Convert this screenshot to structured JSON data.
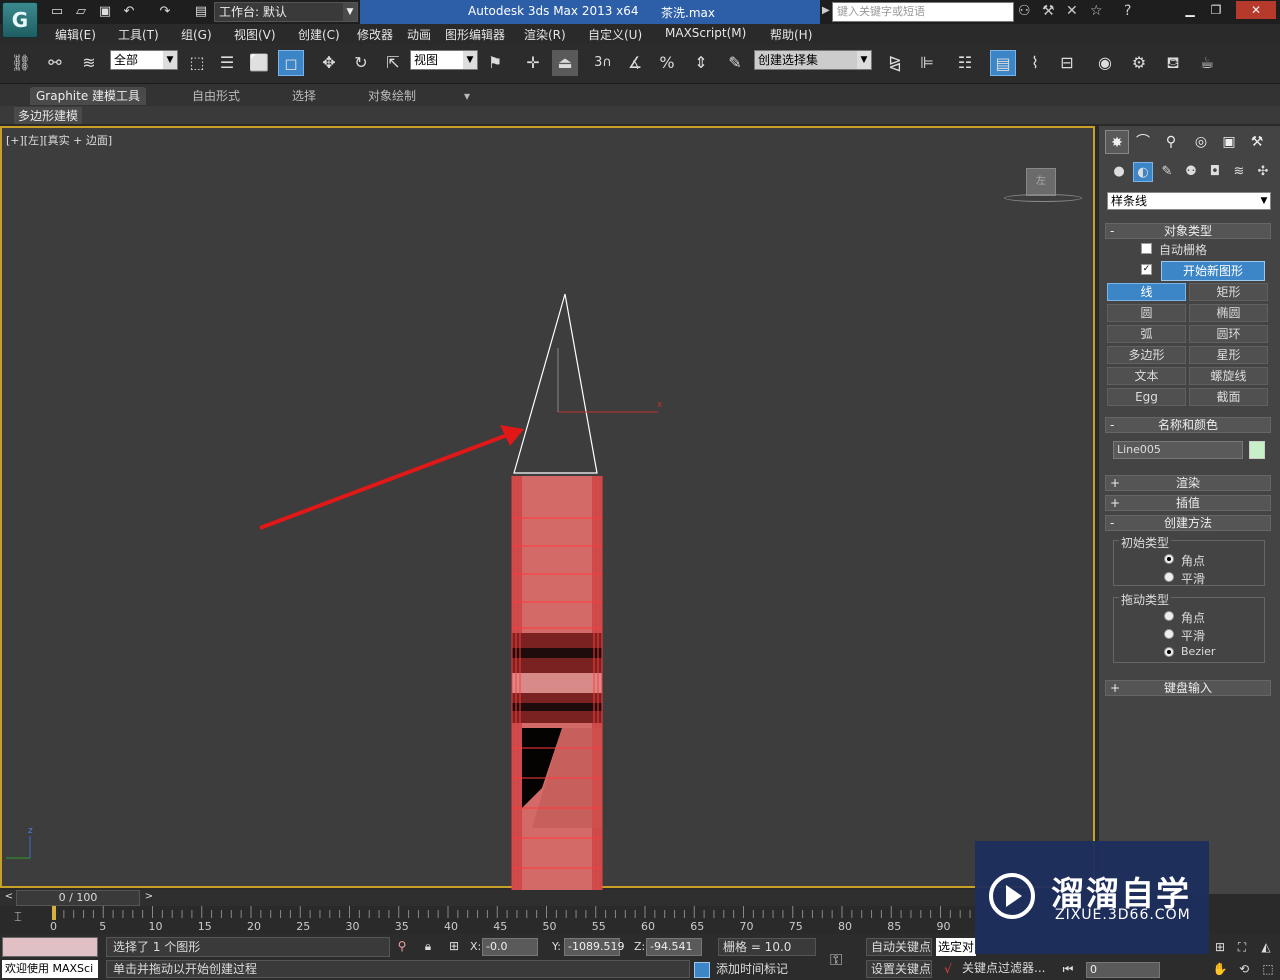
{
  "titlebar": {
    "workspace_label": "工作台: 默认",
    "app_title": "Autodesk 3ds Max  2013 x64",
    "file_title": "茶洗.max",
    "search_placeholder": "键入关键字或短语",
    "blue_color": "#2d5fa8"
  },
  "menu": [
    "编辑(E)",
    "工具(T)",
    "组(G)",
    "视图(V)",
    "创建(C)",
    "修改器",
    "动画",
    "图形编辑器",
    "渲染(R)",
    "自定义(U)",
    "MAXScript(M)",
    "帮助(H)"
  ],
  "toolbar": {
    "filter_value": "全部",
    "ref_coord_value": "视图",
    "named_sel_value": "创建选择集",
    "snap_3_label": "3"
  },
  "ribbon": {
    "tabs": [
      "Graphite 建模工具",
      "自由形式",
      "选择",
      "对象绘制"
    ],
    "panel_label": "多边形建模"
  },
  "viewport": {
    "label": "[+][左][真实 + 边面]",
    "viewcube_label": "左",
    "border_color": "#c8a028",
    "axis_x": "x",
    "axis_z": "z"
  },
  "command_panel": {
    "category_value": "样条线",
    "rollouts": {
      "object_type": "对象类型",
      "name_color": "名称和颜色",
      "rendering": "渲染",
      "interpolation": "插值",
      "creation_method": "创建方法",
      "keyboard_entry": "键盘输入"
    },
    "auto_grid_label": "自动栅格",
    "start_new_shape_label": "开始新图形",
    "object_buttons": [
      "线",
      "矩形",
      "圆",
      "椭圆",
      "弧",
      "圆环",
      "多边形",
      "星形",
      "文本",
      "螺旋线",
      "Egg",
      "截面"
    ],
    "name_value": "Line005",
    "swatch_color": "#c8f0c8",
    "initial_type": {
      "title": "初始类型",
      "options": [
        "角点",
        "平滑"
      ],
      "selected": "角点"
    },
    "drag_type": {
      "title": "拖动类型",
      "options": [
        "角点",
        "平滑",
        "Bezier"
      ],
      "selected": "Bezier"
    }
  },
  "timeline": {
    "frame_display": "0 / 100",
    "tick_labels": [
      "0",
      "5",
      "10",
      "15",
      "20",
      "25",
      "30",
      "35",
      "40",
      "45",
      "50",
      "55",
      "60",
      "65",
      "70",
      "75",
      "80",
      "85",
      "90"
    ]
  },
  "statusbar": {
    "selection_text": "选择了 1 个图形",
    "prompt_text": "单击并拖动以开始创建过程",
    "welcome_text": "欢迎使用 MAXSci",
    "x_label": "X:",
    "x_value": "-0.0",
    "y_label": "Y:",
    "y_value": "-1089.519",
    "z_label": "Z:",
    "z_value": "-94.541",
    "grid_text": "栅格 = 10.0",
    "add_time_tag": "添加时间标记",
    "auto_key": "自动关键点",
    "set_key": "设置关键点",
    "selected_value": "选定对",
    "key_filters": "关键点过滤器...",
    "frame_value": "0"
  },
  "watermark": {
    "title": "溜溜自学",
    "url": "ZIXUE.3D66.COM"
  }
}
